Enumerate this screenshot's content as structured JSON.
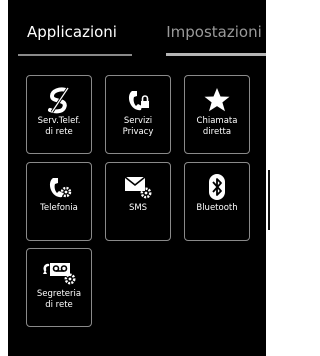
{
  "tabs": {
    "applications": "Applicazioni",
    "settings": "Impostazioni"
  },
  "tiles": [
    {
      "icon": "network-services-icon",
      "line1": "Serv.Telef.",
      "line2": "di rete"
    },
    {
      "icon": "privacy-services-icon",
      "line1": "Servizi",
      "line2": "Privacy"
    },
    {
      "icon": "star-icon",
      "line1": "Chiamata",
      "line2": "diretta"
    },
    {
      "icon": "telephony-settings-icon",
      "line1": "Telefonia",
      "line2": ""
    },
    {
      "icon": "sms-settings-icon",
      "line1": "SMS",
      "line2": ""
    },
    {
      "icon": "bluetooth-icon",
      "line1": "Bluetooth",
      "line2": ""
    },
    {
      "icon": "voicemail-settings-icon",
      "line1": "Segreteria",
      "line2": "di rete"
    }
  ],
  "colors": {
    "background": "#000000",
    "tile_border": "#8a8a8a",
    "active_tab_text": "#ffffff",
    "inactive_tab_text": "#9a9a9a"
  }
}
